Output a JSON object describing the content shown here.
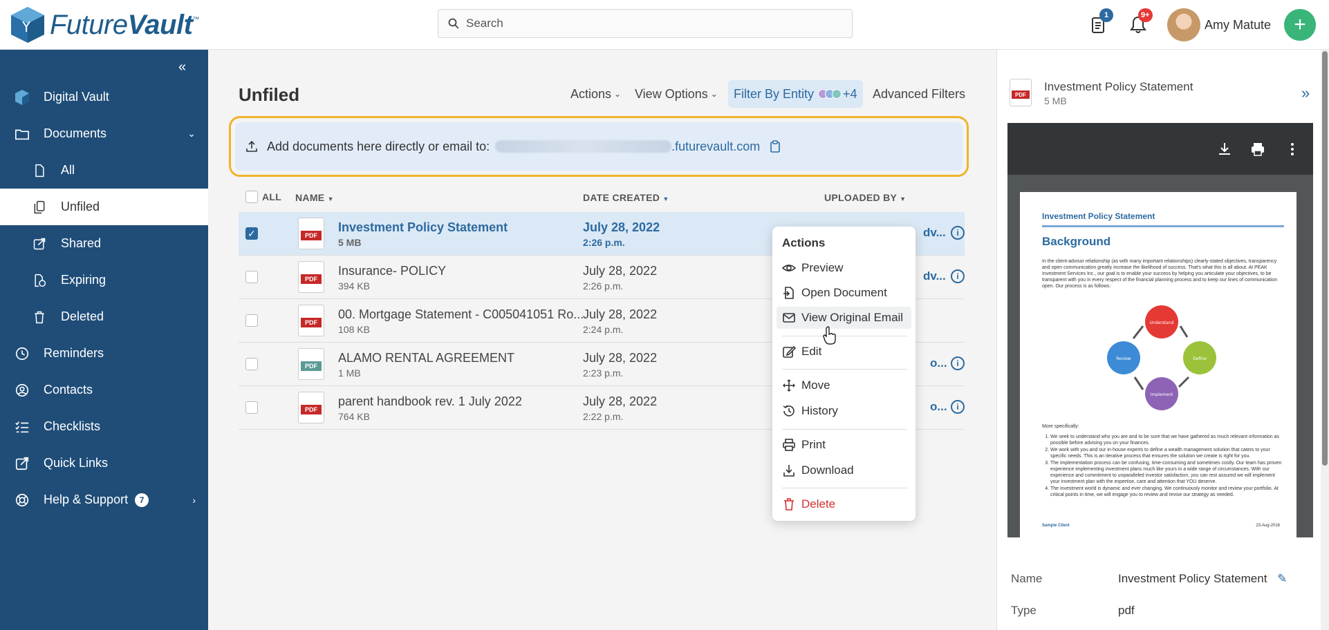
{
  "brand": {
    "name_part1": "Future",
    "name_part2": "Vault",
    "tm": "™"
  },
  "search": {
    "placeholder": "Search"
  },
  "header": {
    "doc_badge": "1",
    "bell_badge": "9+",
    "user_name": "Amy Matute",
    "add_label": "+"
  },
  "sidebar": {
    "collapse_label": "«",
    "items": [
      {
        "label": "Digital Vault"
      },
      {
        "label": "Documents"
      },
      {
        "label": "All"
      },
      {
        "label": "Unfiled"
      },
      {
        "label": "Shared"
      },
      {
        "label": "Expiring"
      },
      {
        "label": "Deleted"
      },
      {
        "label": "Reminders"
      },
      {
        "label": "Contacts"
      },
      {
        "label": "Checklists"
      },
      {
        "label": "Quick Links"
      },
      {
        "label": "Help & Support",
        "badge": "7"
      }
    ]
  },
  "main": {
    "title": "Unfiled",
    "toolbar": {
      "actions": "Actions",
      "view_options": "View Options",
      "filter_entity": "Filter By Entity",
      "filter_count": "+4",
      "advanced_filters": "Advanced Filters"
    },
    "dropzone": {
      "text": "Add documents here directly or email to:",
      "email_domain": ".futurevault.com"
    },
    "columns": {
      "all": "ALL",
      "name": "NAME",
      "date": "DATE CREATED",
      "uploaded_by": "UPLOADED BY"
    },
    "rows": [
      {
        "name": "Investment Policy Statement",
        "size": "5 MB",
        "date": "July 28, 2022",
        "time": "2:26 p.m.",
        "uploader": "dv...",
        "icon_type": "PDF",
        "icon_color": "#c62828"
      },
      {
        "name": "Insurance- POLICY",
        "size": "394 KB",
        "date": "July 28, 2022",
        "time": "2:26 p.m.",
        "uploader": "dv...",
        "icon_type": "PDF",
        "icon_color": "#c62828"
      },
      {
        "name": "00. Mortgage Statement - C005041051 Ro...",
        "size": "108 KB",
        "date": "July 28, 2022",
        "time": "2:24 p.m.",
        "uploader": "",
        "icon_type": "PDF",
        "icon_color": "#c62828"
      },
      {
        "name": "ALAMO RENTAL AGREEMENT",
        "size": "1 MB",
        "date": "July 28, 2022",
        "time": "2:23 p.m.",
        "uploader": "o...",
        "icon_type": "PDF",
        "icon_color": "#5a9a94"
      },
      {
        "name": "parent handbook rev. 1 July 2022",
        "size": "764 KB",
        "date": "July 28, 2022",
        "time": "2:22 p.m.",
        "uploader": "o...",
        "icon_type": "PDF",
        "icon_color": "#c62828"
      }
    ]
  },
  "context_menu": {
    "title": "Actions",
    "items": [
      "Preview",
      "Open Document",
      "View Original Email",
      "Edit",
      "Move",
      "History",
      "Print",
      "Download",
      "Delete"
    ]
  },
  "right_panel": {
    "title": "Investment Policy Statement",
    "size": "5 MB",
    "icon_type": "PDF",
    "doc": {
      "header": "Investment Policy Statement",
      "heading": "Background",
      "paragraph": "In the client-advisor relationship (as with many important relationships) clearly-stated objectives, transparency and open communication greatly increase the likelihood of success. That's what this is all about. At PEAK Investment Services Inc., our goal is to enable your success by helping you articulate your objectives, to be transparent with you in every respect of the financial planning process and to keep our lines of communication open. Our process is as follows:",
      "cycle": [
        "Understand",
        "Define",
        "Implement",
        "Review"
      ],
      "more": "More specifically:",
      "list": [
        "We seek to understand who you are and to be sure that we have gathered as much relevant information as possible before advising you on your finances.",
        "We work with you and our in-house experts to define a wealth management solution that caters to your specific needs. This is an iterative process that ensures the solution we create is right for you.",
        "The implementation process can be confusing, time-consuming and sometimes costly. Our team has proven experience implementing investment plans much like yours in a wide range of circumstances. With our experience and commitment to unparalleled investor satisfaction, you can rest assured we will implement your investment plan with the expertise, care and attention that YOU deserve.",
        "The investment world is dynamic and ever changing. We continuously monitor and review your portfolio. At critical points in time, we will engage you to review and revise our strategy as needed."
      ],
      "footer_left": "Sample Client",
      "footer_right": "23-Aug-2016"
    },
    "meta": [
      {
        "label": "Name",
        "value": "Investment Policy Statement"
      },
      {
        "label": "Type",
        "value": "pdf"
      }
    ]
  },
  "colors": {
    "brand_blue": "#1f4d78",
    "accent": "#2c6aa0",
    "highlight": "#f0b428",
    "green": "#39b57a",
    "danger": "#d32f2f"
  }
}
